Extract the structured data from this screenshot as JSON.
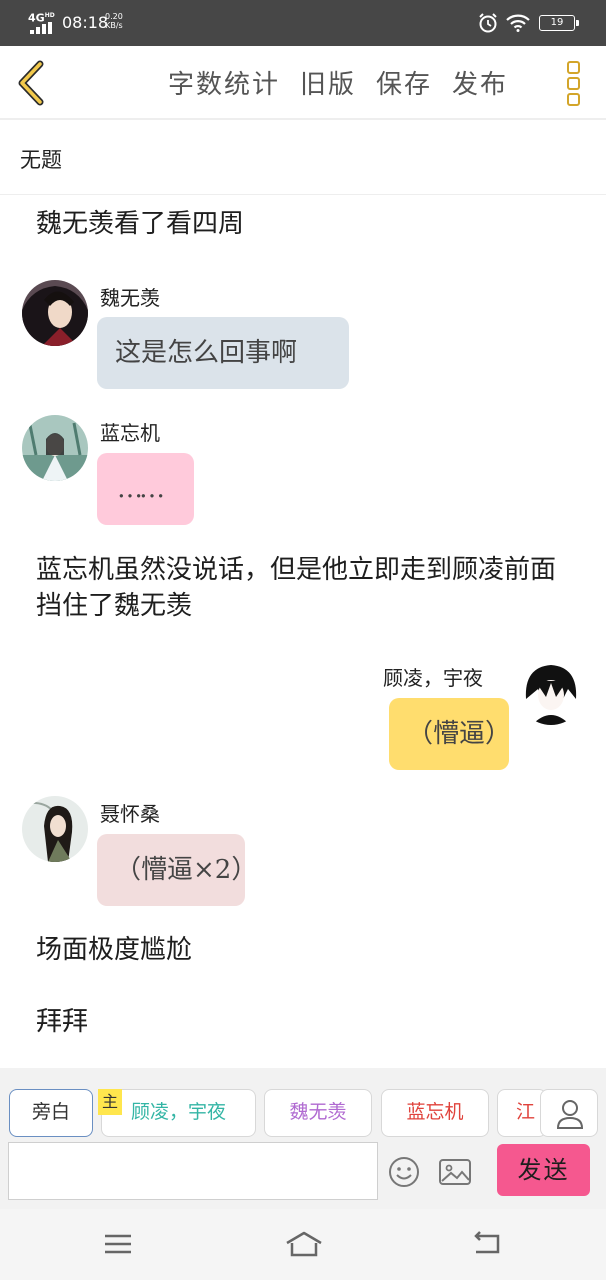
{
  "status_bar": {
    "network": "4G",
    "network_sup": "HD",
    "time": "08:18",
    "speed_value": "0.20",
    "speed_unit": "KB/s",
    "battery": "19"
  },
  "toolbar": {
    "back_icon": "chevron-left-icon",
    "actions": [
      "字数统计",
      "旧版",
      "保存",
      "发布"
    ],
    "more_icon": "three-squares-icon"
  },
  "document": {
    "title": "无题"
  },
  "story": [
    {
      "type": "narration",
      "text": "魏无羡看了看四周"
    },
    {
      "type": "message",
      "side": "left",
      "name": "魏无羡",
      "text": "这是怎么回事啊",
      "bubble_color": "#dbe3ea"
    },
    {
      "type": "message",
      "side": "left",
      "name": "蓝忘机",
      "text": "……",
      "bubble_color": "#ffcadb"
    },
    {
      "type": "narration",
      "text": "蓝忘机虽然没说话，但是他立即走到顾凌前面挡住了魏无羡"
    },
    {
      "type": "message",
      "side": "right",
      "name": "顾凌，宇夜",
      "text": "（懵逼）",
      "bubble_color": "#ffdd6e"
    },
    {
      "type": "message",
      "side": "left",
      "name": "聂怀桑",
      "text": "（懵逼×2）",
      "bubble_color": "#f2dddd"
    },
    {
      "type": "narration",
      "text": "场面极度尴尬"
    },
    {
      "type": "narration",
      "text": "拜拜"
    }
  ],
  "composer": {
    "chips": [
      {
        "label": "旁白",
        "color": "#333333"
      },
      {
        "label": "顾凌，宇夜",
        "color": "#33b5a5"
      },
      {
        "label": "魏无羡",
        "color": "#b06ad1"
      },
      {
        "label": "蓝忘机",
        "color": "#e0433c"
      },
      {
        "label": "江",
        "color": "#e0433c"
      }
    ],
    "protagonist_tag": "主",
    "input_value": "",
    "send_label": "发送",
    "emoji_icon": "smiley-icon",
    "image_icon": "image-icon",
    "person_icon": "person-icon"
  },
  "navbar": {
    "icons": [
      "menu-icon",
      "home-icon",
      "back-icon"
    ]
  }
}
